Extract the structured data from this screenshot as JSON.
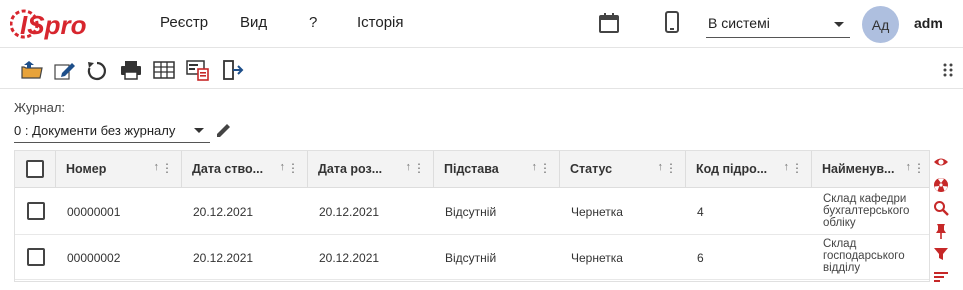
{
  "brand": {
    "logo_text": "ISpro"
  },
  "menu": {
    "items": [
      {
        "label": "Реєстр"
      },
      {
        "label": "Вид"
      },
      {
        "label": "?"
      },
      {
        "label": "Історія"
      }
    ]
  },
  "status_select": {
    "value": "В системі"
  },
  "user": {
    "initials": "Ад",
    "name": "adm"
  },
  "colors": {
    "brand_red": "#d7262e",
    "icon_red": "#c62828",
    "icon_blue": "#1e4f8a",
    "avatar_bg": "#aebfdf"
  },
  "toolbar": {
    "icons": [
      "open-folder-icon",
      "edit-document-icon",
      "refresh-icon",
      "print-icon",
      "table-icon",
      "report-icon",
      "exit-icon"
    ]
  },
  "journal": {
    "label": "Журнал:",
    "value": "0 : Документи без журналу"
  },
  "table": {
    "columns": [
      "Номер",
      "Дата ство...",
      "Дата роз...",
      "Підстава",
      "Статус",
      "Код підро...",
      "Найменув..."
    ],
    "rows": [
      {
        "number": "00000001",
        "created": "20.12.2021",
        "posted": "20.12.2021",
        "basis": "Відсутній",
        "status": "Чернетка",
        "code": "4",
        "name": "Склад кафедри бухгалтерського обліку"
      },
      {
        "number": "00000002",
        "created": "20.12.2021",
        "posted": "20.12.2021",
        "basis": "Відсутній",
        "status": "Чернетка",
        "code": "6",
        "name": "Склад господарського відділу"
      }
    ]
  },
  "side_rail": {
    "icons": [
      "eye-icon",
      "radiation-icon",
      "search-icon",
      "pin-icon",
      "filter-icon",
      "sort-icon"
    ]
  }
}
